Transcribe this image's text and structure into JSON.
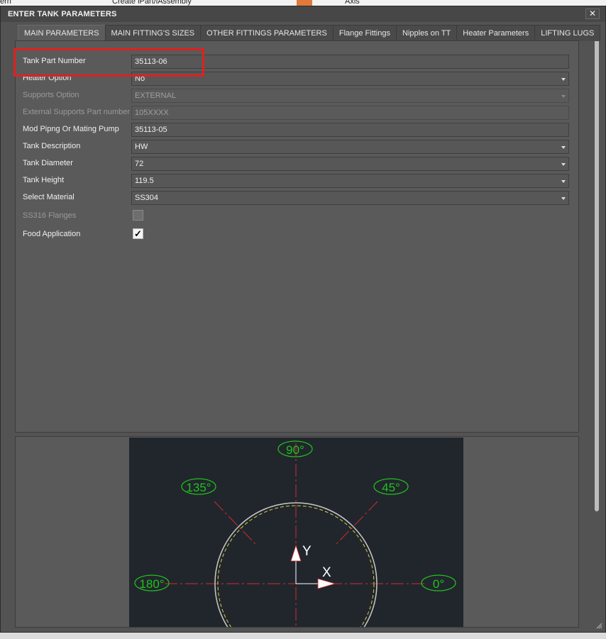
{
  "background_app": {
    "fragments": [
      "ern",
      "Create iPart/iAssembly",
      "Axis"
    ]
  },
  "dialog": {
    "title": "ENTER TANK PARAMETERS",
    "close_glyph": "✕"
  },
  "tabs": [
    {
      "label": "MAIN PARAMETERS",
      "active": true
    },
    {
      "label": "MAIN FITTING'S SIZES",
      "active": false
    },
    {
      "label": "OTHER FITTINGS PARAMETERS",
      "active": false
    },
    {
      "label": "Flange Fittings",
      "active": false
    },
    {
      "label": "Nipples on TT",
      "active": false
    },
    {
      "label": "Heater Parameters",
      "active": false
    },
    {
      "label": "LIFTING LUGS",
      "active": false
    }
  ],
  "form": {
    "tank_part_number": {
      "label": "Tank Part Number",
      "value": "35113-06"
    },
    "heater_option": {
      "label": "Heater Option",
      "value": "No"
    },
    "supports_option": {
      "label": "Supports Option",
      "value": "EXTERNAL"
    },
    "external_supports_part_number": {
      "label": "External Supports Part number",
      "value": "105XXXX"
    },
    "mod_piping": {
      "label": "Mod Pipng Or Mating Pump",
      "value": "35113-05"
    },
    "tank_description": {
      "label": "Tank Description",
      "value": "HW"
    },
    "tank_diameter": {
      "label": "Tank Diameter",
      "value": "72"
    },
    "tank_height": {
      "label": "Tank Height",
      "value": "119.5"
    },
    "select_material": {
      "label": "Select Material",
      "value": "SS304"
    },
    "ss316_flanges": {
      "label": "SS316 Flanges",
      "checked": false
    },
    "food_application": {
      "label": "Food Application",
      "checked": true,
      "check_glyph": "✓"
    }
  },
  "diagram": {
    "angles": [
      "90°",
      "135°",
      "45°",
      "180°",
      "0°"
    ],
    "axis_labels": {
      "y": "Y",
      "x": "X"
    },
    "colors": {
      "background": "#21262d",
      "label": "#21c21c",
      "centerline": "#d42a2a",
      "circle": "#c8c8c8",
      "dashed_circle": "#d8d040"
    }
  },
  "colors": {
    "highlight": "#e02020"
  }
}
